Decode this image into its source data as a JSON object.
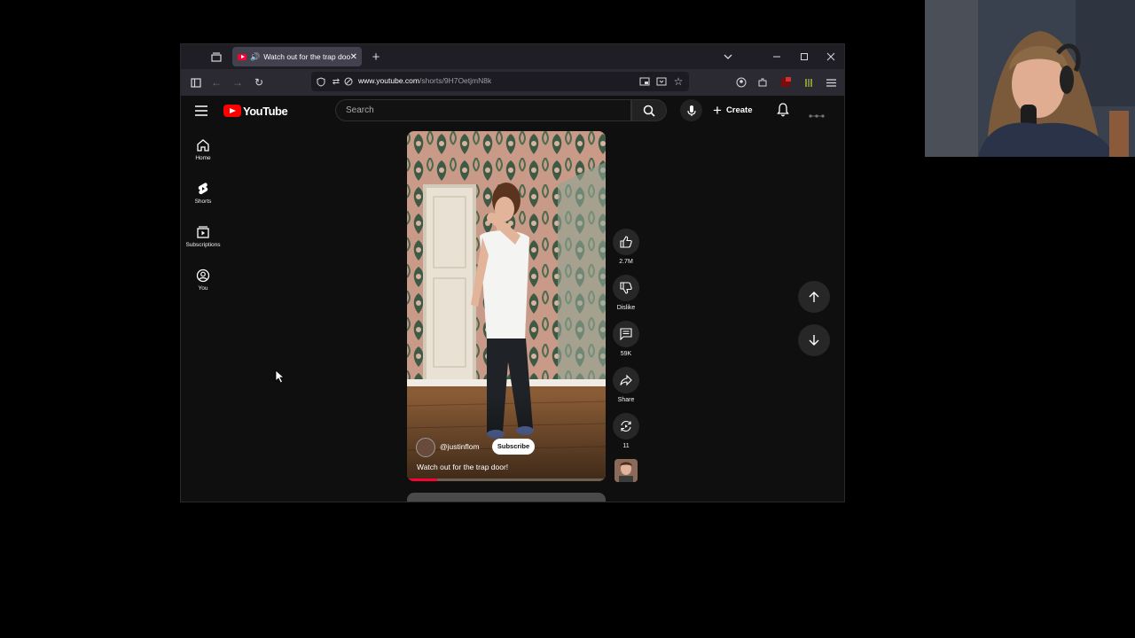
{
  "browser": {
    "tab_title": "Watch out for the trap door!",
    "url_host": "www.youtube.com",
    "url_path": "/shorts/9H7OetjmN8k"
  },
  "youtube": {
    "logo_text": "YouTube",
    "search_placeholder": "Search",
    "create_label": "Create",
    "sidebar": [
      {
        "label": "Home",
        "icon": "home-icon"
      },
      {
        "label": "Shorts",
        "icon": "shorts-icon"
      },
      {
        "label": "Subscriptions",
        "icon": "subscriptions-icon"
      },
      {
        "label": "You",
        "icon": "you-icon"
      }
    ],
    "short": {
      "channel": "@justinflom",
      "subscribe_label": "Subscribe",
      "caption": "Watch out for the trap door!",
      "progress_fraction": 0.15
    },
    "actions": {
      "like_count": "2.7M",
      "dislike_label": "Dislike",
      "comments_count": "59K",
      "share_label": "Share",
      "remix_count": "11"
    }
  },
  "colors": {
    "youtube_red": "#ff0000",
    "progress": "#ff0033",
    "background": "#0f0f0f"
  }
}
